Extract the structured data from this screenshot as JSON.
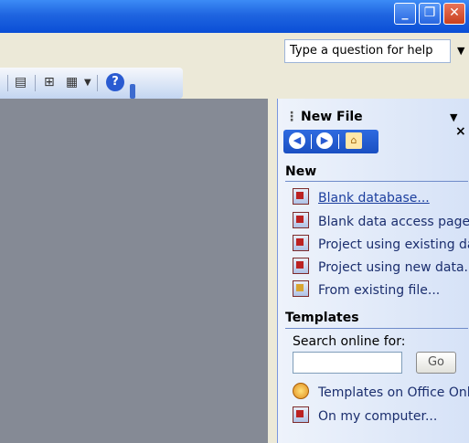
{
  "window": {
    "buttons": {
      "minimize": "_",
      "restore": "❐",
      "close": "✕"
    }
  },
  "help": {
    "placeholder": "Type a question for help"
  },
  "taskpane": {
    "title": "New File",
    "controls": {
      "menu": "▼",
      "close": "×"
    },
    "sections": {
      "new": {
        "title": "New",
        "items": [
          {
            "label": "Blank database...",
            "icon": "database-icon",
            "link": true
          },
          {
            "label": "Blank data access page...",
            "icon": "data-access-page-icon",
            "link": false
          },
          {
            "label": "Project using existing data",
            "icon": "project-existing-icon",
            "link": false
          },
          {
            "label": "Project using new data...",
            "icon": "project-new-icon",
            "link": false
          },
          {
            "label": "From existing file...",
            "icon": "existing-file-icon",
            "link": false
          }
        ]
      },
      "templates": {
        "title": "Templates",
        "search_label": "Search online for:",
        "go_label": "Go",
        "items": [
          {
            "label": "Templates on Office Online",
            "icon": "globe-icon"
          },
          {
            "label": "On my computer...",
            "icon": "computer-icon"
          }
        ]
      }
    }
  },
  "colors": {
    "titlebar": "#1F65E0",
    "workspace": "#858A95",
    "link": "#1B3E9E"
  }
}
